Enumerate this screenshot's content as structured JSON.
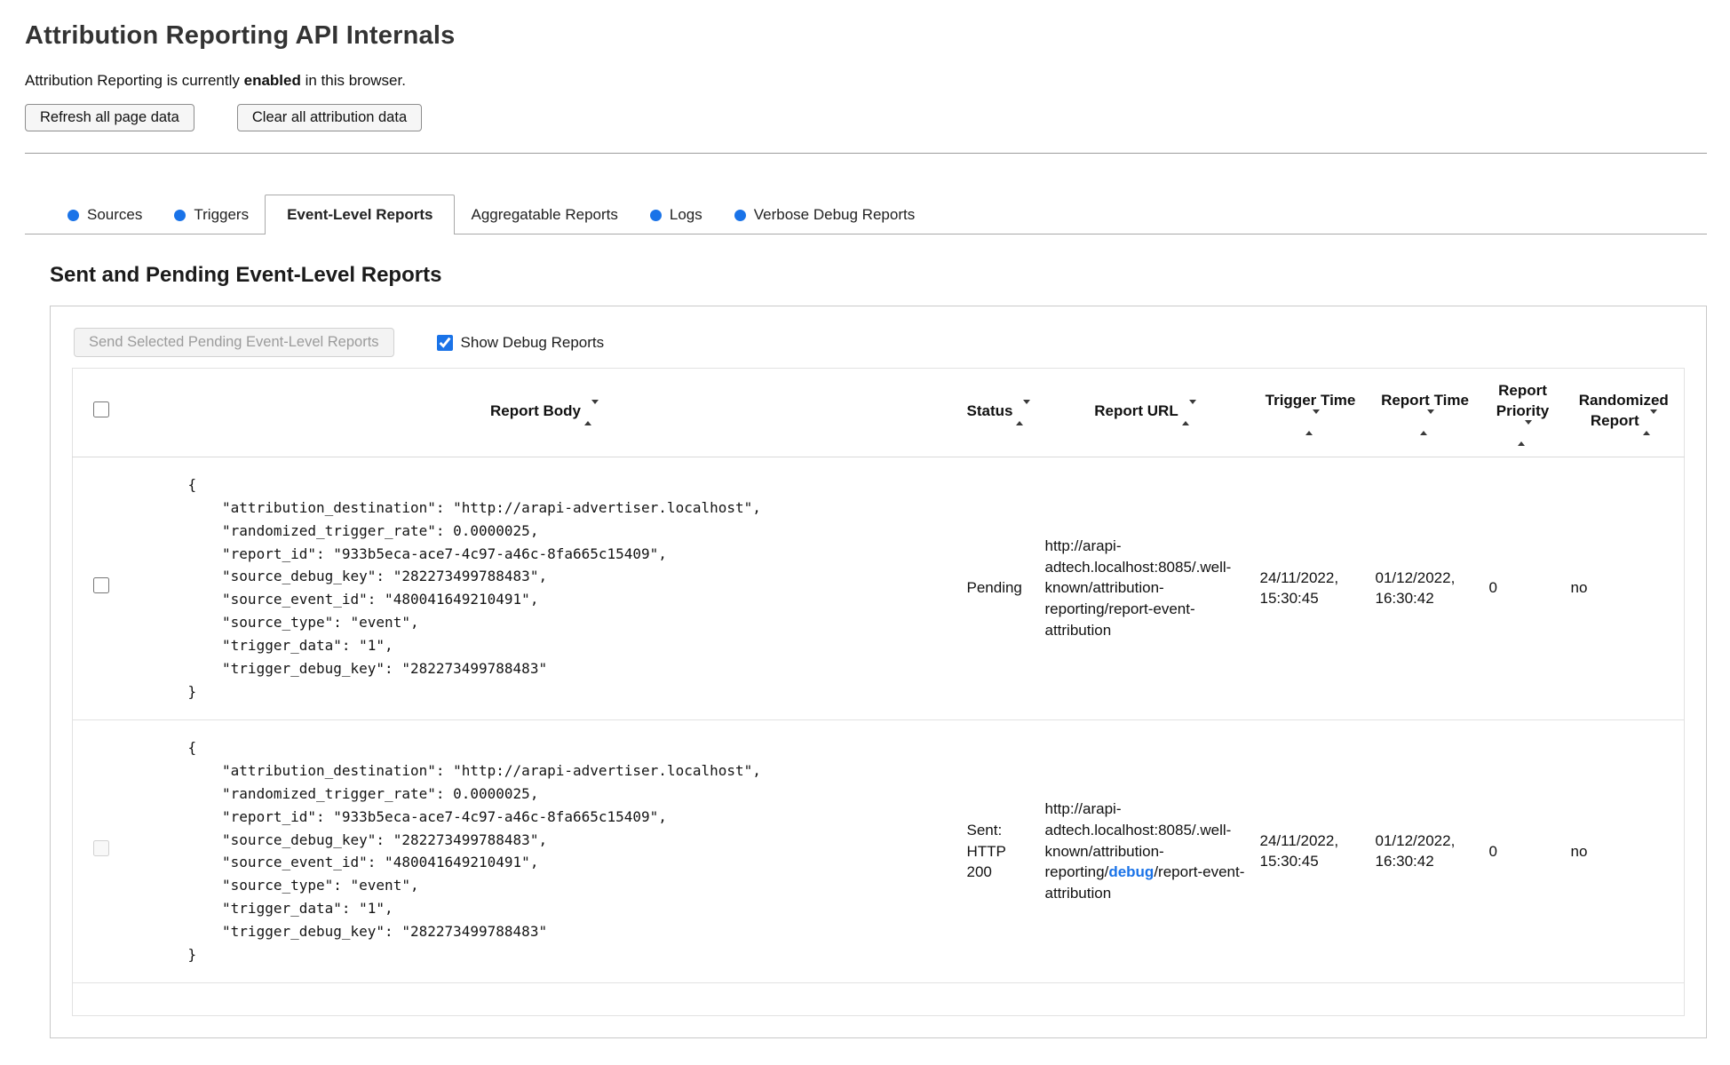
{
  "header": {
    "title": "Attribution Reporting API Internals",
    "status_prefix": "Attribution Reporting is currently ",
    "status_bold": "enabled",
    "status_suffix": " in this browser.",
    "refresh_button": "Refresh all page data",
    "clear_button": "Clear all attribution data"
  },
  "tabs": [
    {
      "label": "Sources",
      "has_dot": true,
      "active": false
    },
    {
      "label": "Triggers",
      "has_dot": true,
      "active": false
    },
    {
      "label": "Event-Level Reports",
      "has_dot": false,
      "active": true
    },
    {
      "label": "Aggregatable Reports",
      "has_dot": false,
      "active": false
    },
    {
      "label": "Logs",
      "has_dot": true,
      "active": false
    },
    {
      "label": "Verbose Debug Reports",
      "has_dot": true,
      "active": false
    }
  ],
  "colors": {
    "accent_blue": "#1a73e8"
  },
  "section": {
    "title": "Sent and Pending Event-Level Reports",
    "send_button": "Send Selected Pending Event-Level Reports",
    "show_debug_label": "Show Debug Reports",
    "show_debug_checked": true
  },
  "table": {
    "headers": [
      "Report Body",
      "Status",
      "Report URL",
      "Trigger Time",
      "Report Time",
      "Report Priority",
      "Randomized Report"
    ],
    "rows": [
      {
        "body": "{\n    \"attribution_destination\": \"http://arapi-advertiser.localhost\",\n    \"randomized_trigger_rate\": 0.0000025,\n    \"report_id\": \"933b5eca-ace7-4c97-a46c-8fa665c15409\",\n    \"source_debug_key\": \"282273499788483\",\n    \"source_event_id\": \"480041649210491\",\n    \"source_type\": \"event\",\n    \"trigger_data\": \"1\",\n    \"trigger_debug_key\": \"282273499788483\"\n}",
        "status": "Pending",
        "url_pre": "http://arapi-adtech.localhost:8085/.well-known/attribution-reporting/report-event-attribution",
        "url_debug": "",
        "url_post": "",
        "trigger_time": "24/11/2022, 15:30:45",
        "report_time": "01/12/2022, 16:30:42",
        "priority": "0",
        "randomized": "no",
        "checkbox_enabled": true
      },
      {
        "body": "{\n    \"attribution_destination\": \"http://arapi-advertiser.localhost\",\n    \"randomized_trigger_rate\": 0.0000025,\n    \"report_id\": \"933b5eca-ace7-4c97-a46c-8fa665c15409\",\n    \"source_debug_key\": \"282273499788483\",\n    \"source_event_id\": \"480041649210491\",\n    \"source_type\": \"event\",\n    \"trigger_data\": \"1\",\n    \"trigger_debug_key\": \"282273499788483\"\n}",
        "status": "Sent: HTTP 200",
        "url_pre": "http://arapi-adtech.localhost:8085/.well-known/attribution-reporting/",
        "url_debug": "debug",
        "url_post": "/report-event-attribution",
        "trigger_time": "24/11/2022, 15:30:45",
        "report_time": "01/12/2022, 16:30:42",
        "priority": "0",
        "randomized": "no",
        "checkbox_enabled": false
      }
    ]
  }
}
